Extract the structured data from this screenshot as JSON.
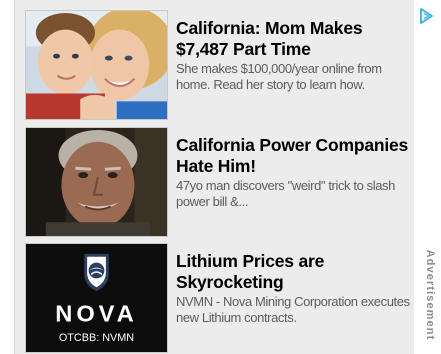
{
  "ads": [
    {
      "headline": "California: Mom Makes $7,487 Part Time",
      "description": "She makes $100,000/year online from home. Read her story to learn how.",
      "image": "mother-and-child-photo"
    },
    {
      "headline": "California Power Companies Hate Him!",
      "description": "47yo man discovers \"weird\" trick to slash power bill &...",
      "image": "man-portrait-photo"
    },
    {
      "headline": "Lithium Prices are Skyrocketing",
      "description": "NVMN - Nova Mining Corporation executes new Lithium contracts.",
      "image": "nova-logo",
      "logo": {
        "name": "NOVA",
        "ticker": "OTCBB: NVMN"
      }
    }
  ],
  "adchoices_icon": "adchoices-triangle-icon",
  "advertisement_label": "Advertisement",
  "colors": {
    "panel_background": "#ececec",
    "headline": "#000000",
    "description": "#5c5c5c",
    "adchoices": "#2fb5e0",
    "label": "#8a8a8a",
    "logo_background": "#0c0c0c"
  }
}
